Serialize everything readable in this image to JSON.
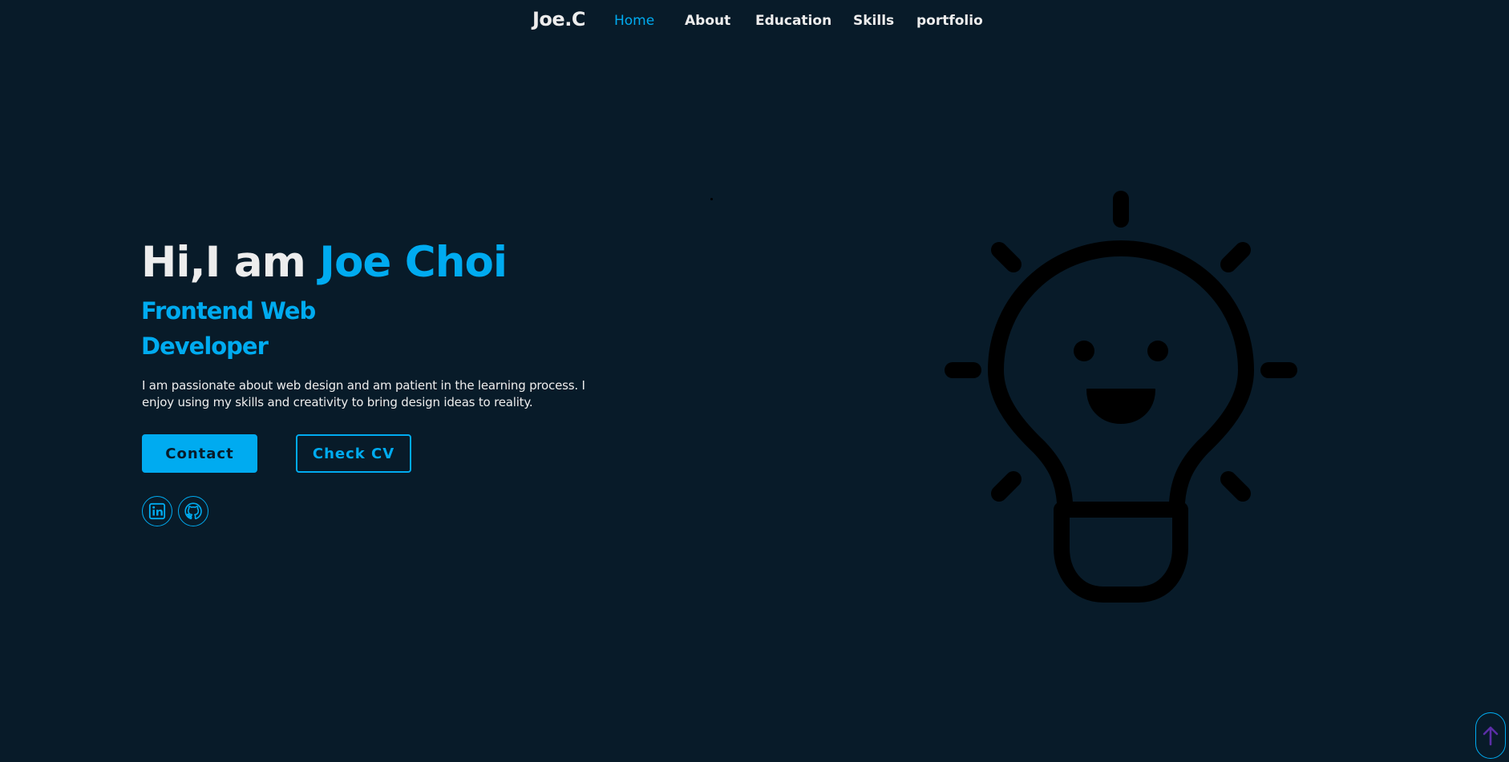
{
  "header": {
    "logo": "Joe.C",
    "nav": [
      {
        "label": "Home",
        "active": true
      },
      {
        "label": "About",
        "active": false
      },
      {
        "label": "Education",
        "active": false
      },
      {
        "label": "Skills",
        "active": false
      },
      {
        "label": "portfolio",
        "active": false
      }
    ]
  },
  "home": {
    "greeting": "Hi,I am",
    "name": "Joe Choi",
    "role_line1": "Frontend Web",
    "role_line2": "Developer",
    "bio": "I am passionate about web design and am patient in the learning process. I enjoy using my skills and creativity to bring design ideas to reality.",
    "buttons": {
      "contact": "Contact",
      "cv": "Check CV"
    },
    "social": [
      {
        "icon": "linkedin-icon"
      },
      {
        "icon": "github-icon"
      }
    ],
    "illustration": {
      "icon": "lightbulb-smiley-icon"
    }
  },
  "scroll_top": {
    "icon": "arrow-up-icon"
  },
  "colors": {
    "background": "#081b29",
    "accent": "#00abf0",
    "text": "#ededed",
    "illustration": "#000000",
    "scroll_arrow": "#5b2ea6"
  }
}
